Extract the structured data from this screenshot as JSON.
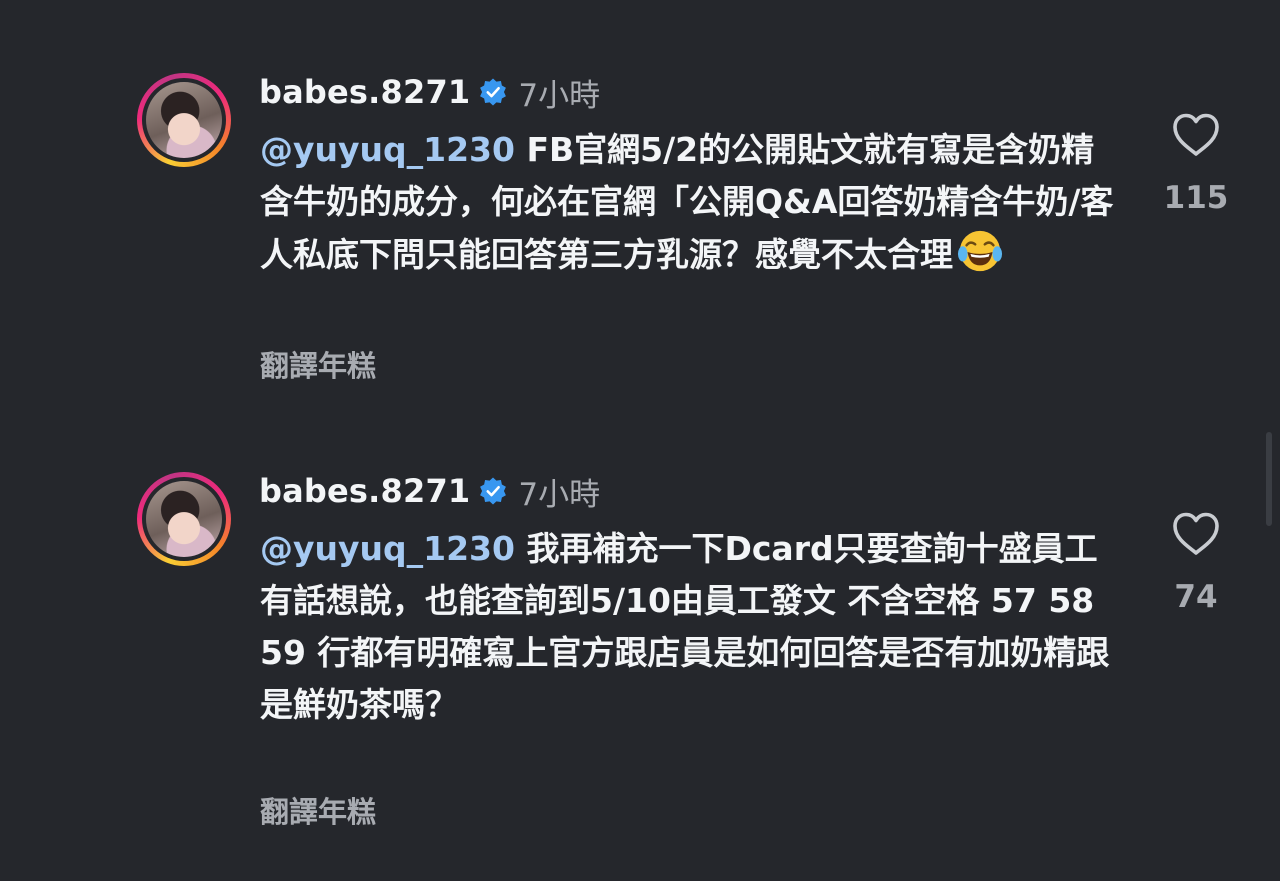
{
  "comments": [
    {
      "username": "babes.8271",
      "time": "7小時",
      "mention": "@yuyuq_1230",
      "body": " FB官網5/2的公開貼文就有寫是含奶精含牛奶的成分，何必在官網「公開Q&A回答奶精含牛奶/客人私底下問只能回答第三方乳源？感覺不太合理",
      "emoji": "😂",
      "translate": "翻譯年糕",
      "likes": "115"
    },
    {
      "username": "babes.8271",
      "time": "7小時",
      "mention": "@yuyuq_1230",
      "body": " 我再補充一下Dcard只要查詢十盛員工有話想說，也能查詢到5/10由員工發文 不含空格 57 58 59 行都有明確寫上官方跟店員是如何回答是否有加奶精跟是鮮奶茶嗎？",
      "translate": "翻譯年糕",
      "likes": "74"
    }
  ],
  "colors": {
    "background": "#25272c",
    "mention": "#a5c9f2",
    "verified": "#3897f0",
    "secondary_text": "#a8abb1"
  },
  "icons": {
    "verified": "verified-badge-icon",
    "like": "heart-outline-icon",
    "emoji": "tears-of-joy-emoji"
  }
}
